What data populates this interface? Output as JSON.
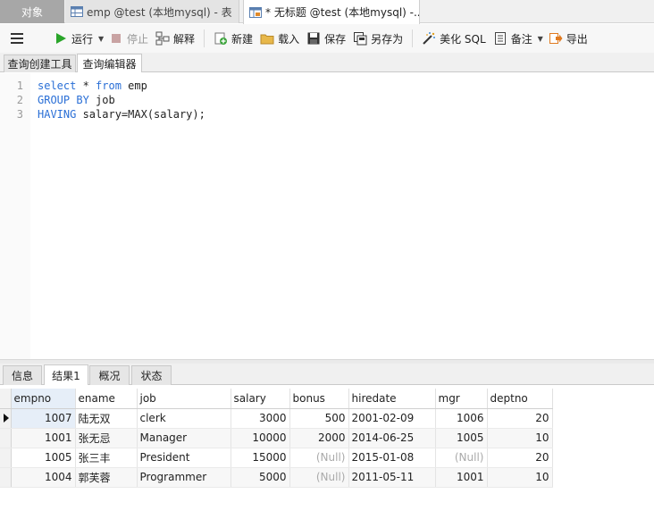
{
  "tabs": {
    "objects": "对象",
    "emp_table": "emp @test (本地mysql) - 表",
    "query": "* 无标题 @test (本地mysql) -..."
  },
  "toolbar": {
    "run": "运行",
    "stop": "停止",
    "explain": "解释",
    "new": "新建",
    "load": "载入",
    "save": "保存",
    "save_as": "另存为",
    "beautify": "美化 SQL",
    "comment": "备注",
    "export": "导出"
  },
  "sub_tabs": {
    "builder": "查询创建工具",
    "editor": "查询编辑器"
  },
  "editor": {
    "line_numbers": [
      "1",
      "2",
      "3"
    ],
    "lines": [
      [
        {
          "t": "select",
          "kw": true
        },
        {
          "t": " * ",
          "kw": false
        },
        {
          "t": "from",
          "kw": true
        },
        {
          "t": " emp",
          "kw": false
        }
      ],
      [
        {
          "t": "GROUP BY",
          "kw": true
        },
        {
          "t": " job",
          "kw": false
        }
      ],
      [
        {
          "t": "HAVING",
          "kw": true
        },
        {
          "t": " salary=MAX(salary);",
          "kw": false
        }
      ]
    ]
  },
  "result_tabs": {
    "info": "信息",
    "result1": "结果1",
    "overview": "概况",
    "status": "状态"
  },
  "grid": {
    "columns": [
      "empno",
      "ename",
      "job",
      "salary",
      "bonus",
      "hiredate",
      "mgr",
      "deptno"
    ],
    "rows": [
      [
        "1007",
        "陆无双",
        "clerk",
        "3000",
        "500",
        "2001-02-09",
        "1006",
        "20"
      ],
      [
        "1001",
        "张无忌",
        "Manager",
        "10000",
        "2000",
        "2014-06-25",
        "1005",
        "10"
      ],
      [
        "1005",
        "张三丰",
        "President",
        "15000",
        "(Null)",
        "2015-01-08",
        "(Null)",
        "20"
      ],
      [
        "1004",
        "郭芙蓉",
        "Programmer",
        "5000",
        "(Null)",
        "2011-05-11",
        "1001",
        "10"
      ]
    ]
  },
  "colors": {
    "keyword": "#2a6fd6",
    "run_icon": "#2aa52a",
    "null_text": "#aaaaaa"
  }
}
